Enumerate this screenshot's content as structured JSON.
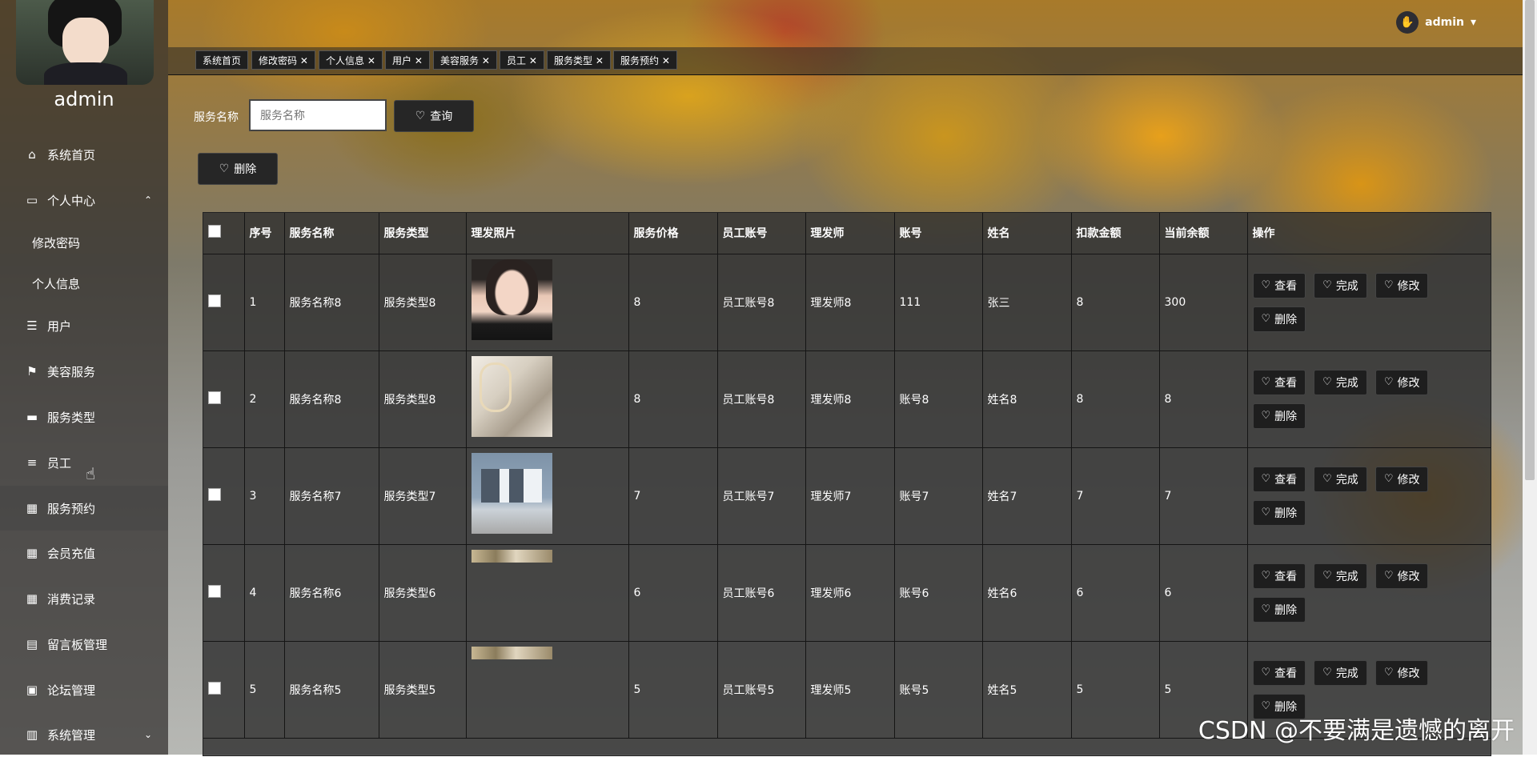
{
  "sidebar": {
    "user_name": "admin",
    "items": [
      {
        "label": "系统首页",
        "icon": "home-icon"
      },
      {
        "label": "个人中心",
        "icon": "card-icon"
      },
      {
        "label": "修改密码"
      },
      {
        "label": "个人信息"
      },
      {
        "label": "用户",
        "icon": "list-icon"
      },
      {
        "label": "美容服务",
        "icon": "flag-icon"
      },
      {
        "label": "服务类型",
        "icon": "chat-icon"
      },
      {
        "label": "员工",
        "icon": "menu-icon"
      },
      {
        "label": "服务预约",
        "icon": "grid-icon"
      },
      {
        "label": "会员充值",
        "icon": "grid-icon"
      },
      {
        "label": "消费记录",
        "icon": "grid-icon"
      },
      {
        "label": "留言板管理",
        "icon": "printer-icon"
      },
      {
        "label": "论坛管理",
        "icon": "briefcase-icon"
      },
      {
        "label": "系统管理",
        "icon": "clipboard-icon"
      }
    ]
  },
  "header": {
    "user": "admin"
  },
  "tabs": [
    "系统首页",
    "修改密码",
    "个人信息",
    "用户",
    "美容服务",
    "员工",
    "服务类型",
    "服务预约"
  ],
  "search": {
    "label": "服务名称",
    "placeholder": "服务名称",
    "button": "查询"
  },
  "toolbar": {
    "delete": "删除"
  },
  "table": {
    "headers": [
      "序号",
      "服务名称",
      "服务类型",
      "理发照片",
      "服务价格",
      "员工账号",
      "理发师",
      "账号",
      "姓名",
      "扣款金额",
      "当前余额",
      "操作"
    ],
    "rows": [
      {
        "no": "1",
        "service_name": "服务名称8",
        "service_type": "服务类型8",
        "price": "8",
        "staff_account": "员工账号8",
        "barber": "理发师8",
        "account": "111",
        "name": "张三",
        "deduction": "8",
        "balance": "300"
      },
      {
        "no": "2",
        "service_name": "服务名称8",
        "service_type": "服务类型8",
        "price": "8",
        "staff_account": "员工账号8",
        "barber": "理发师8",
        "account": "账号8",
        "name": "姓名8",
        "deduction": "8",
        "balance": "8"
      },
      {
        "no": "3",
        "service_name": "服务名称7",
        "service_type": "服务类型7",
        "price": "7",
        "staff_account": "员工账号7",
        "barber": "理发师7",
        "account": "账号7",
        "name": "姓名7",
        "deduction": "7",
        "balance": "7"
      },
      {
        "no": "4",
        "service_name": "服务名称6",
        "service_type": "服务类型6",
        "price": "6",
        "staff_account": "员工账号6",
        "barber": "理发师6",
        "account": "账号6",
        "name": "姓名6",
        "deduction": "6",
        "balance": "6"
      },
      {
        "no": "5",
        "service_name": "服务名称5",
        "service_type": "服务类型5",
        "price": "5",
        "staff_account": "员工账号5",
        "barber": "理发师5",
        "account": "账号5",
        "name": "姓名5",
        "deduction": "5",
        "balance": "5"
      }
    ],
    "actions": {
      "view": "查看",
      "complete": "完成",
      "edit": "修改",
      "delete": "删除"
    }
  },
  "watermark": "CSDN @不要满是遗憾的离开"
}
